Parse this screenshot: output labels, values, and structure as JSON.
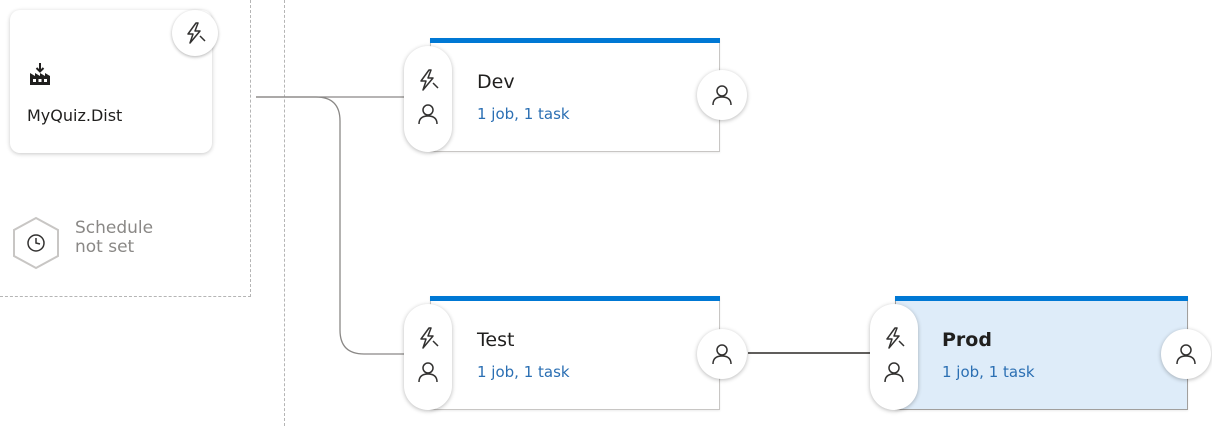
{
  "artifact": {
    "name": "MyQuiz.Dist",
    "icon": "build-package-icon",
    "trigger_icon": "lightning-icon"
  },
  "schedule": {
    "line1": "Schedule",
    "line2": "not set",
    "icon": "clock-icon"
  },
  "stages": [
    {
      "name": "Dev",
      "summary": "1 job, 1 task",
      "selected": false
    },
    {
      "name": "Test",
      "summary": "1 job, 1 task",
      "selected": false
    },
    {
      "name": "Prod",
      "summary": "1 job, 1 task",
      "selected": true
    }
  ],
  "colors": {
    "accent": "#0078d4",
    "selected_bg": "#deecf9",
    "link": "#2b6fb3",
    "muted": "#8a8886"
  }
}
